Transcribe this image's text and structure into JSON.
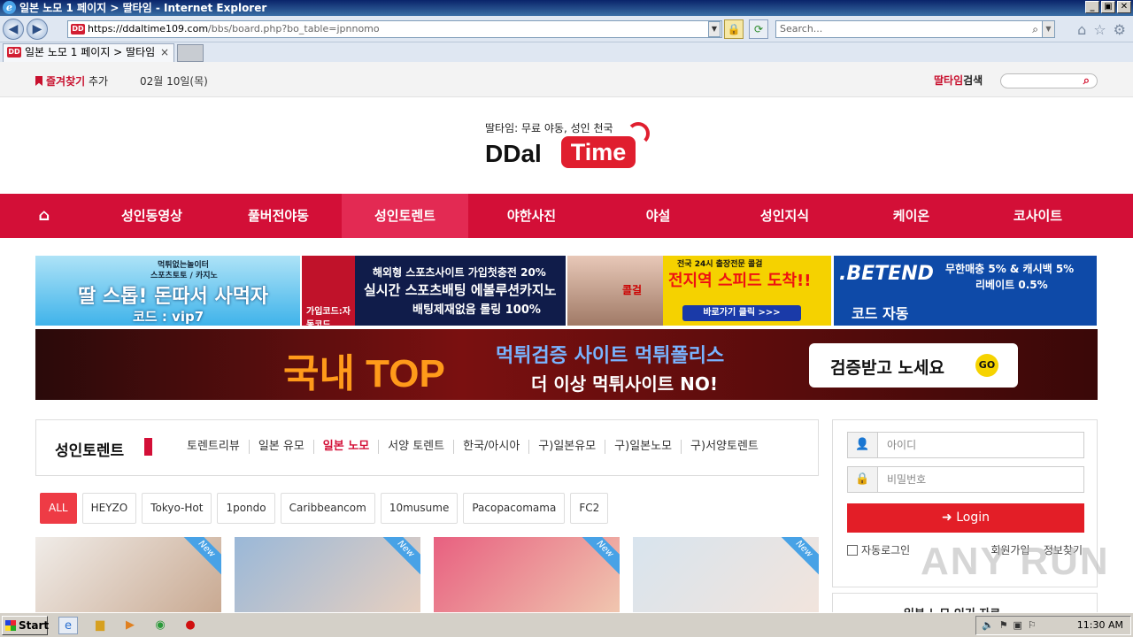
{
  "window": {
    "title": "일본 노모 1 페이지 > 딸타임 - Internet Explorer",
    "minimize": "_",
    "maximize": "▣",
    "close": "✕"
  },
  "addressbar": {
    "url_host": "https://ddaltime109.com",
    "url_path": "/bbs/board.php?bo_table=jpnnomo",
    "search_placeholder": "Search..."
  },
  "tab": {
    "label": "일본 노모 1 페이지 > 딸타임",
    "close": "×"
  },
  "site": {
    "bookmark_label": "즐겨찾기",
    "bookmark_add": "추가",
    "date": "02월 10일(목)",
    "search_brand": "딸타임",
    "search_label": "검색",
    "logo_tagline": "딸타임: 무료 야동, 성인 천국",
    "logo_word1": "DDal",
    "logo_word2": "Time"
  },
  "nav": {
    "items": [
      "성인동영상",
      "풀버전야동",
      "성인토렌트",
      "야한사진",
      "야설",
      "성인지식",
      "케이온",
      "코사이트"
    ],
    "active_index": 2
  },
  "banners": [
    {
      "lines": [
        "먹튀없는놀이터",
        "스포츠토토 / 카지노",
        "딸 스톱! 돈따서 사먹자",
        "코드 : vip7"
      ]
    },
    {
      "lines": [
        "해외형 스포츠사이트 가입첫충전 20%",
        "실시간 스포츠배팅 에볼루션카지노",
        "배팅제재없음 롤링 100%",
        "가입코드:자동코드"
      ]
    },
    {
      "lines": [
        "전국 24시 출장전문 콜걸",
        "전지역 스피드 도착!!",
        "바로가기 클릭 >>>",
        "콜걸"
      ]
    },
    {
      "lines": [
        ".BETEND",
        "무한매충 5% & 캐시백 5%",
        "리베이트 0.5%",
        "코드 자동"
      ]
    }
  ],
  "big_banner": {
    "headline": "국내 TOP",
    "line1": "먹튀검증 사이트 먹튀폴리스",
    "line2": "더 이상 먹튀사이트 NO!",
    "cta": "검증받고 노세요",
    "cta_badge": "GO"
  },
  "board": {
    "title": "성인토렌트",
    "subnav": [
      "토렌트리뷰",
      "일본 유모",
      "일본 노모",
      "서양 토렌트",
      "한국/아시아",
      "구)일본유모",
      "구)일본노모",
      "구)서양토렌트"
    ],
    "subnav_active": 2,
    "filters": [
      "ALL",
      "HEYZO",
      "Tokyo-Hot",
      "1pondo",
      "Caribbeancom",
      "10musume",
      "Pacopacomama",
      "FC2"
    ],
    "badge_new": "New"
  },
  "login": {
    "id_placeholder": "아이디",
    "pw_placeholder": "비밀번호",
    "login_button": "Login",
    "auto_login": "자동로그인",
    "join": "회원가입",
    "find": "정보찾기"
  },
  "sidebar_card": {
    "title": "일본 노모 인기 자료"
  },
  "watermark": "ANY RUN",
  "taskbar": {
    "start": "Start",
    "clock": "11:30 AM"
  }
}
